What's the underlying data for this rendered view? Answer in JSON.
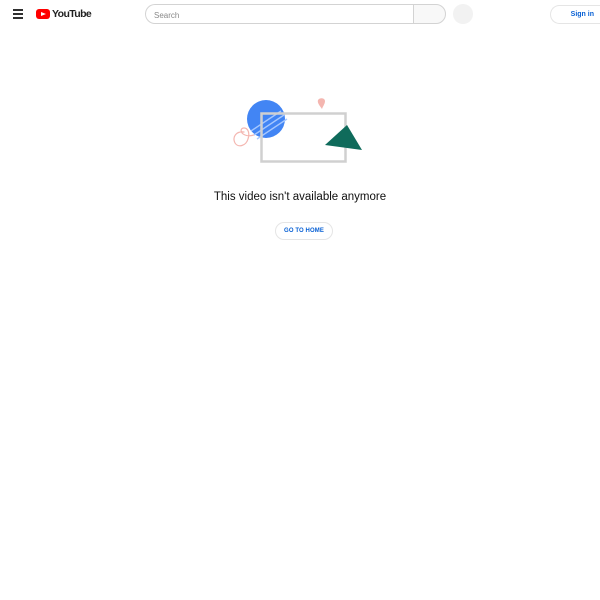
{
  "header": {
    "logo_text": "YouTube",
    "search_placeholder": "Search",
    "sign_in_label": "Sign in"
  },
  "main": {
    "message": "This video isn't available anymore",
    "home_button_label": "GO TO HOME"
  },
  "colors": {
    "brand_red": "#ff0000",
    "link_blue": "#065fd4",
    "illustration_blue": "#4285f4",
    "illustration_green": "#0f6b5b",
    "illustration_pink": "#f4b6b0"
  },
  "icons": [
    "menu-icon",
    "youtube-logo-icon",
    "search-icon",
    "microphone-icon",
    "account-icon"
  ]
}
